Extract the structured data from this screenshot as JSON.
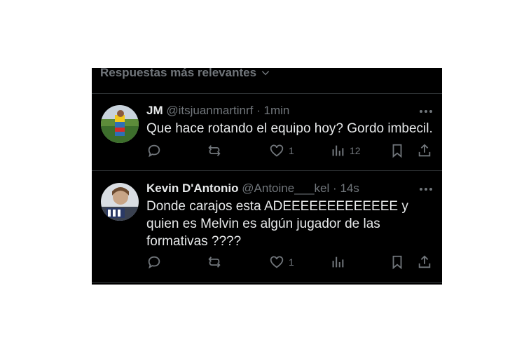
{
  "header": {
    "sort_label": "Respuestas más relevantes"
  },
  "replies": [
    {
      "name": "JM",
      "handle": "@itsjuanmartinrf",
      "separator": "·",
      "time": "1min",
      "text": "Que hace rotando el equipo hoy? Gordo imbecil.",
      "likes": "1",
      "views": "12"
    },
    {
      "name": "Kevin D'Antonio",
      "handle": "@Antoine___kel",
      "separator": "·",
      "time": "14s",
      "text": "Donde carajos esta ADEEEEEEEEEEEEE y quien es Melvin es algún jugador de las formativas ????",
      "likes": "1",
      "views": ""
    }
  ],
  "icons": [
    "chevron-down-icon",
    "more-icon",
    "reply-icon",
    "retweet-icon",
    "like-icon",
    "views-icon",
    "bookmark-icon",
    "share-icon"
  ],
  "colors": {
    "background": "#000000",
    "text": "#e7e9ea",
    "secondary": "#71767b",
    "divider": "#2f3336"
  }
}
